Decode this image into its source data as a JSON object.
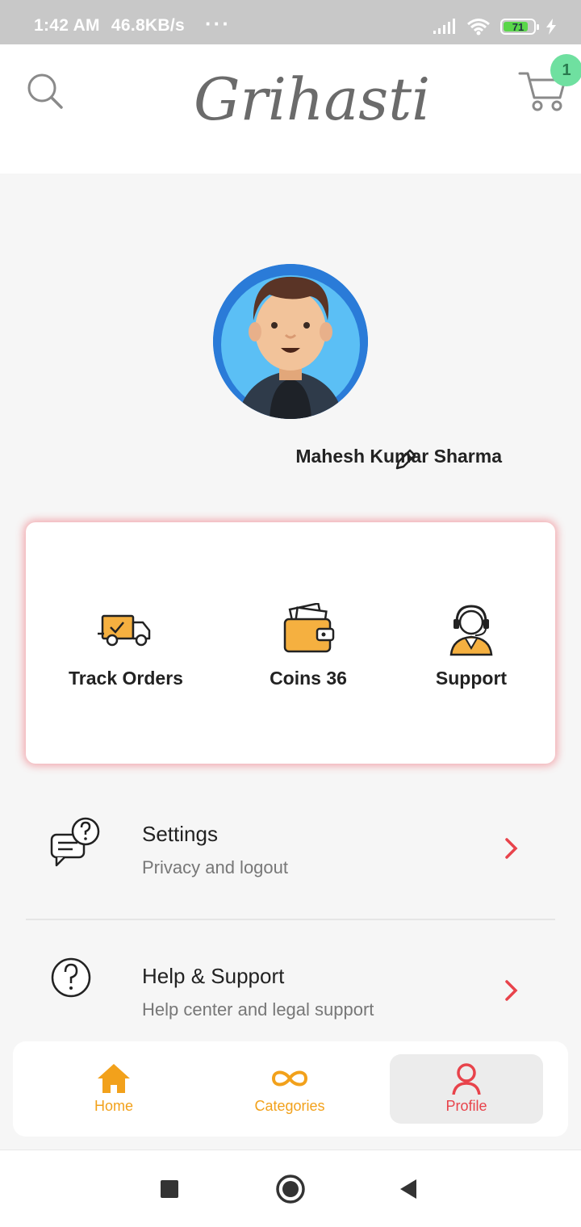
{
  "status_bar": {
    "time": "1:42 AM",
    "speed": "46.8KB/s",
    "dots": "···",
    "battery": "71"
  },
  "header": {
    "logo_text": "Grihasti",
    "cart_count": "1",
    "icons": {
      "search": "search-icon",
      "cart": "cart-icon"
    }
  },
  "profile": {
    "name": "Mahesh Kumar Sharma",
    "icons": {
      "avatar": "avatar-illustration",
      "edit": "pencil-icon"
    }
  },
  "quick_actions": [
    {
      "label": "Track Orders",
      "icon": "delivery-truck-icon"
    },
    {
      "label": "Coins 36",
      "icon": "wallet-icon"
    },
    {
      "label": "Support",
      "icon": "headset-agent-icon"
    }
  ],
  "menu": [
    {
      "title": "Settings",
      "subtitle": "Privacy and logout",
      "icon": "chat-question-icon"
    },
    {
      "title": "Help & Support",
      "subtitle": "Help center and legal support",
      "icon": "question-circle-icon"
    }
  ],
  "bottom_nav": [
    {
      "label": "Home",
      "icon": "home-icon",
      "active": false
    },
    {
      "label": "Categories",
      "icon": "infinity-icon",
      "active": false
    },
    {
      "label": "Profile",
      "icon": "person-icon",
      "active": true
    }
  ],
  "colors": {
    "accent_orange": "#f2a11b",
    "accent_red": "#e8434b",
    "badge_green": "#6fe0a0",
    "avatar_blue": "#2a7bd8"
  }
}
